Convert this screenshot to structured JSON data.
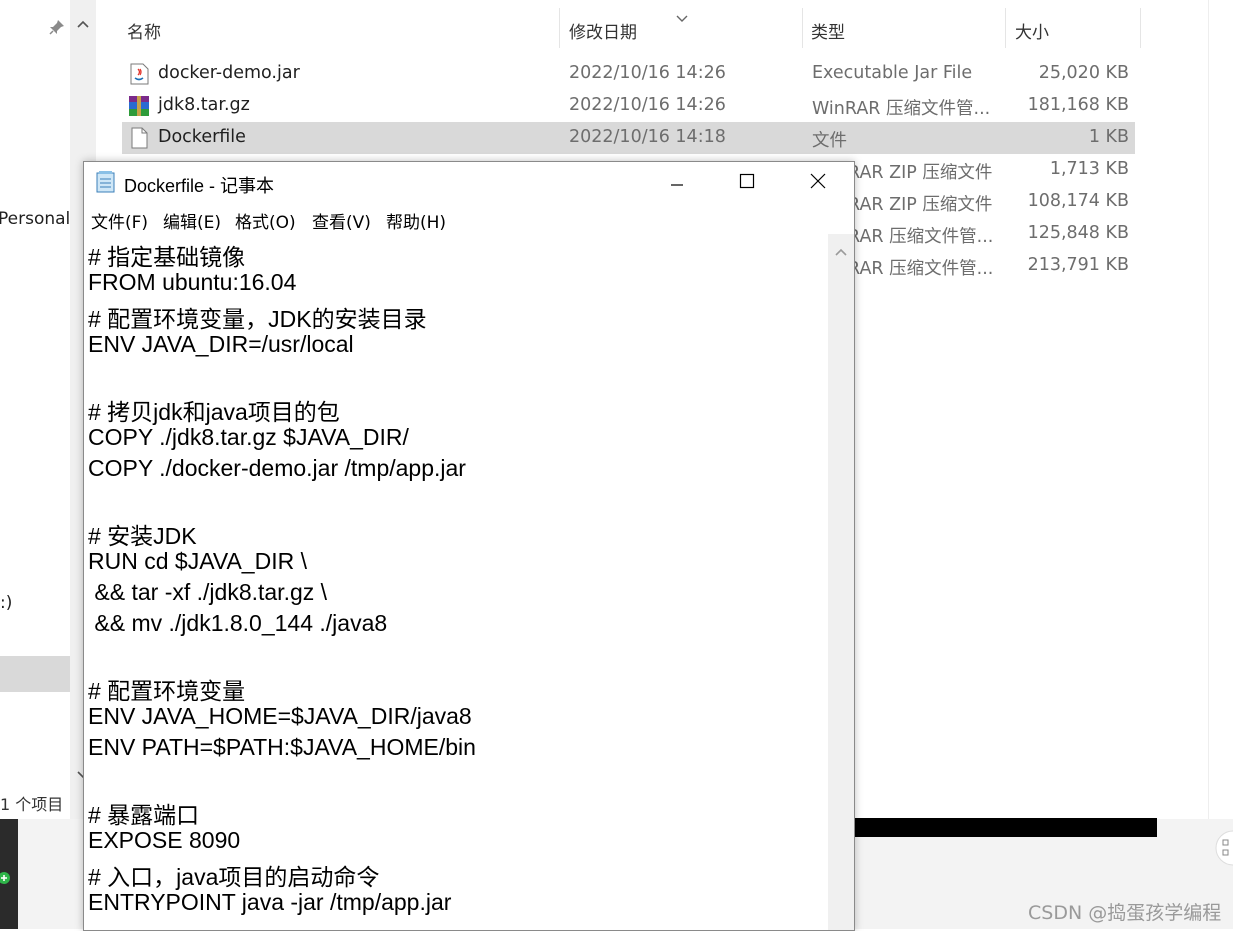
{
  "explorer": {
    "columns": {
      "name": "名称",
      "modified": "修改日期",
      "type": "类型",
      "size": "大小"
    },
    "nav": {
      "personal": "Personal",
      "drive": ":)",
      "status": "1 个项目"
    },
    "files": [
      {
        "name": "docker-demo.jar",
        "date": "2022/10/16 14:26",
        "type": "Executable Jar File",
        "size": "25,020 KB",
        "icon": "java-jar-icon"
      },
      {
        "name": "jdk8.tar.gz",
        "date": "2022/10/16 14:26",
        "type": "WinRAR 压缩文件管...",
        "size": "181,168 KB",
        "icon": "winrar-archive-icon"
      },
      {
        "name": "Dockerfile",
        "date": "2022/10/16 14:18",
        "type": "文件",
        "size": "1 KB",
        "icon": "blank-file-icon"
      },
      {
        "type": "RAR ZIP 压缩文件",
        "size": "1,713 KB"
      },
      {
        "type": "RAR ZIP 压缩文件",
        "size": "108,174 KB"
      },
      {
        "type": "RAR 压缩文件管...",
        "size": "125,848 KB"
      },
      {
        "type": "RAR 压缩文件管...",
        "size": "213,791 KB"
      }
    ]
  },
  "notepad": {
    "title": "Dockerfile - 记事本",
    "menu": [
      "文件(F)",
      "编辑(E)",
      "格式(O)",
      "查看(V)",
      "帮助(H)"
    ],
    "lines": [
      "# 指定基础镜像",
      "FROM ubuntu:16.04",
      "# 配置环境变量，JDK的安装目录",
      "ENV JAVA_DIR=/usr/local",
      "",
      "# 拷贝jdk和java项目的包",
      "COPY ./jdk8.tar.gz $JAVA_DIR/",
      "COPY ./docker-demo.jar /tmp/app.jar",
      "",
      "# 安装JDK",
      "RUN cd $JAVA_DIR \\",
      " && tar -xf ./jdk8.tar.gz \\",
      " && mv ./jdk1.8.0_144 ./java8",
      "",
      "# 配置环境变量",
      "ENV JAVA_HOME=$JAVA_DIR/java8",
      "ENV PATH=$PATH:$JAVA_HOME/bin",
      "",
      "# 暴露端口",
      "EXPOSE 8090",
      "# 入口，java项目的启动命令",
      "ENTRYPOINT java -jar /tmp/app.jar"
    ]
  },
  "watermark": "CSDN @捣蛋孩学编程"
}
